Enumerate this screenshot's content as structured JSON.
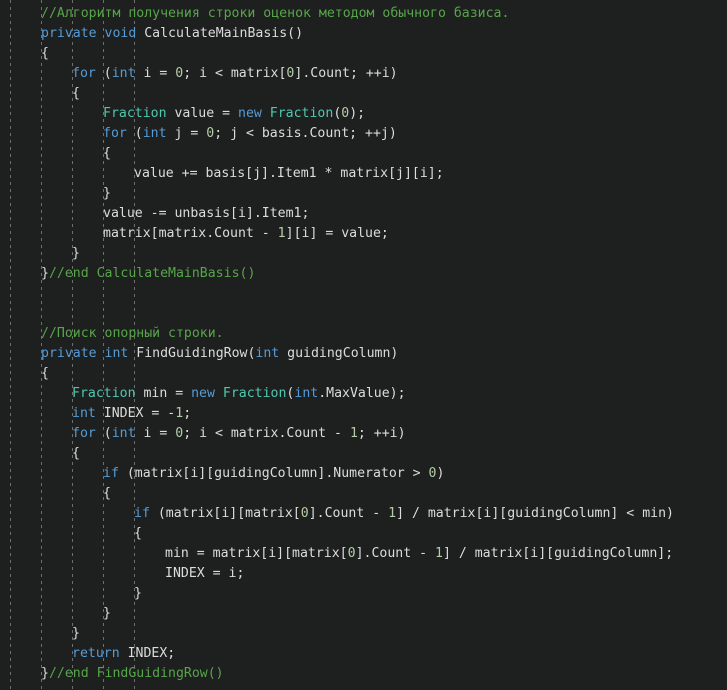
{
  "editor": {
    "name": "code-editor",
    "language": "C#",
    "background_color": "#1e1f1f",
    "indent_guide_color": "#6e6e6e",
    "colors": {
      "comment": "#57a64a",
      "keyword": "#569cd6",
      "type": "#4ec9b0",
      "plain": "#dcdcdc",
      "number": "#b5cea8"
    },
    "indent_guide_x": [
      10,
      41,
      72,
      103,
      134
    ],
    "line_height": 20,
    "char_width": 7.75
  },
  "lines": [
    {
      "n": 1,
      "indent": 4,
      "text": "//Алгоритм получения строки оценок методом обычного базиса.",
      "tokens": [
        {
          "t": "//Алгоритм получения строки оценок методом обычного базиса.",
          "c": "cmt"
        }
      ]
    },
    {
      "n": 2,
      "indent": 4,
      "text": "private void CalculateMainBasis()",
      "tokens": [
        {
          "t": "private",
          "c": "kw"
        },
        {
          "t": " ",
          "c": "pln"
        },
        {
          "t": "void",
          "c": "kw"
        },
        {
          "t": " CalculateMainBasis()",
          "c": "pln"
        }
      ]
    },
    {
      "n": 3,
      "indent": 4,
      "text": "{",
      "tokens": [
        {
          "t": "{",
          "c": "pun"
        }
      ]
    },
    {
      "n": 4,
      "indent": 8,
      "text": "for (int i = 0; i < matrix[0].Count; ++i)",
      "tokens": [
        {
          "t": "for",
          "c": "kw"
        },
        {
          "t": " (",
          "c": "pun"
        },
        {
          "t": "int",
          "c": "kw"
        },
        {
          "t": " i = ",
          "c": "pln"
        },
        {
          "t": "0",
          "c": "num"
        },
        {
          "t": "; i < matrix[",
          "c": "pln"
        },
        {
          "t": "0",
          "c": "num"
        },
        {
          "t": "].Count; ++i)",
          "c": "pln"
        }
      ]
    },
    {
      "n": 5,
      "indent": 8,
      "text": "{",
      "tokens": [
        {
          "t": "{",
          "c": "pun"
        }
      ]
    },
    {
      "n": 6,
      "indent": 12,
      "text": "Fraction value = new Fraction(0);",
      "tokens": [
        {
          "t": "Fraction",
          "c": "typ"
        },
        {
          "t": " value = ",
          "c": "pln"
        },
        {
          "t": "new",
          "c": "kw"
        },
        {
          "t": " ",
          "c": "pln"
        },
        {
          "t": "Fraction",
          "c": "typ"
        },
        {
          "t": "(",
          "c": "pun"
        },
        {
          "t": "0",
          "c": "num"
        },
        {
          "t": ");",
          "c": "pun"
        }
      ]
    },
    {
      "n": 7,
      "indent": 12,
      "text": "for (int j = 0; j < basis.Count; ++j)",
      "tokens": [
        {
          "t": "for",
          "c": "kw"
        },
        {
          "t": " (",
          "c": "pun"
        },
        {
          "t": "int",
          "c": "kw"
        },
        {
          "t": " j = ",
          "c": "pln"
        },
        {
          "t": "0",
          "c": "num"
        },
        {
          "t": "; j < basis.Count; ++j)",
          "c": "pln"
        }
      ]
    },
    {
      "n": 8,
      "indent": 12,
      "text": "{",
      "tokens": [
        {
          "t": "{",
          "c": "pun"
        }
      ]
    },
    {
      "n": 9,
      "indent": 16,
      "text": "value += basis[j].Item1 * matrix[j][i];",
      "tokens": [
        {
          "t": "value += basis[j].Item1 * matrix[j][i];",
          "c": "pln"
        }
      ]
    },
    {
      "n": 10,
      "indent": 12,
      "text": "}",
      "tokens": [
        {
          "t": "}",
          "c": "pun"
        }
      ]
    },
    {
      "n": 11,
      "indent": 12,
      "text": "value -= unbasis[i].Item1;",
      "tokens": [
        {
          "t": "value -= unbasis[i].Item1;",
          "c": "pln"
        }
      ]
    },
    {
      "n": 12,
      "indent": 12,
      "text": "matrix[matrix.Count - 1][i] = value;",
      "tokens": [
        {
          "t": "matrix[matrix.Count - ",
          "c": "pln"
        },
        {
          "t": "1",
          "c": "num"
        },
        {
          "t": "][i] = value;",
          "c": "pln"
        }
      ]
    },
    {
      "n": 13,
      "indent": 8,
      "text": "}",
      "tokens": [
        {
          "t": "}",
          "c": "pun"
        }
      ]
    },
    {
      "n": 14,
      "indent": 4,
      "text": "}//end CalculateMainBasis()",
      "tokens": [
        {
          "t": "}",
          "c": "pun"
        },
        {
          "t": "//end CalculateMainBasis()",
          "c": "cmt"
        }
      ]
    },
    {
      "n": 15,
      "indent": 0,
      "text": "",
      "tokens": []
    },
    {
      "n": 16,
      "indent": 0,
      "text": "",
      "tokens": []
    },
    {
      "n": 17,
      "indent": 4,
      "text": "//Поиск опорный строки.",
      "tokens": [
        {
          "t": "//Поиск опорный строки.",
          "c": "cmt"
        }
      ]
    },
    {
      "n": 18,
      "indent": 4,
      "text": "private int FindGuidingRow(int guidingColumn)",
      "tokens": [
        {
          "t": "private",
          "c": "kw"
        },
        {
          "t": " ",
          "c": "pln"
        },
        {
          "t": "int",
          "c": "kw"
        },
        {
          "t": " FindGuidingRow(",
          "c": "pln"
        },
        {
          "t": "int",
          "c": "kw"
        },
        {
          "t": " guidingColumn)",
          "c": "pln"
        }
      ]
    },
    {
      "n": 19,
      "indent": 4,
      "text": "{",
      "tokens": [
        {
          "t": "{",
          "c": "pun"
        }
      ]
    },
    {
      "n": 20,
      "indent": 8,
      "text": "Fraction min = new Fraction(int.MaxValue);",
      "tokens": [
        {
          "t": "Fraction",
          "c": "typ"
        },
        {
          "t": " min = ",
          "c": "pln"
        },
        {
          "t": "new",
          "c": "kw"
        },
        {
          "t": " ",
          "c": "pln"
        },
        {
          "t": "Fraction",
          "c": "typ"
        },
        {
          "t": "(",
          "c": "pun"
        },
        {
          "t": "int",
          "c": "kw"
        },
        {
          "t": ".MaxValue);",
          "c": "pln"
        }
      ]
    },
    {
      "n": 21,
      "indent": 8,
      "text": "int INDEX = -1;",
      "tokens": [
        {
          "t": "int",
          "c": "kw"
        },
        {
          "t": " INDEX = -",
          "c": "pln"
        },
        {
          "t": "1",
          "c": "num"
        },
        {
          "t": ";",
          "c": "pun"
        }
      ]
    },
    {
      "n": 22,
      "indent": 8,
      "text": "for (int i = 0; i < matrix.Count - 1; ++i)",
      "tokens": [
        {
          "t": "for",
          "c": "kw"
        },
        {
          "t": " (",
          "c": "pun"
        },
        {
          "t": "int",
          "c": "kw"
        },
        {
          "t": " i = ",
          "c": "pln"
        },
        {
          "t": "0",
          "c": "num"
        },
        {
          "t": "; i < matrix.Count - ",
          "c": "pln"
        },
        {
          "t": "1",
          "c": "num"
        },
        {
          "t": "; ++i)",
          "c": "pln"
        }
      ]
    },
    {
      "n": 23,
      "indent": 8,
      "text": "{",
      "tokens": [
        {
          "t": "{",
          "c": "pun"
        }
      ]
    },
    {
      "n": 24,
      "indent": 12,
      "text": "if (matrix[i][guidingColumn].Numerator > 0)",
      "tokens": [
        {
          "t": "if",
          "c": "kw"
        },
        {
          "t": " (matrix[i][guidingColumn].Numerator > ",
          "c": "pln"
        },
        {
          "t": "0",
          "c": "num"
        },
        {
          "t": ")",
          "c": "pun"
        }
      ]
    },
    {
      "n": 25,
      "indent": 12,
      "text": "{",
      "tokens": [
        {
          "t": "{",
          "c": "pun"
        }
      ]
    },
    {
      "n": 26,
      "indent": 16,
      "text": "if (matrix[i][matrix[0].Count - 1] / matrix[i][guidingColumn] < min)",
      "tokens": [
        {
          "t": "if",
          "c": "kw"
        },
        {
          "t": " (matrix[i][matrix[",
          "c": "pln"
        },
        {
          "t": "0",
          "c": "num"
        },
        {
          "t": "].Count - ",
          "c": "pln"
        },
        {
          "t": "1",
          "c": "num"
        },
        {
          "t": "] / matrix[i][guidingColumn] < min)",
          "c": "pln"
        }
      ]
    },
    {
      "n": 27,
      "indent": 16,
      "text": "{",
      "tokens": [
        {
          "t": "{",
          "c": "pun"
        }
      ]
    },
    {
      "n": 28,
      "indent": 20,
      "text": "min = matrix[i][matrix[0].Count - 1] / matrix[i][guidingColumn];",
      "tokens": [
        {
          "t": "min = matrix[i][matrix[",
          "c": "pln"
        },
        {
          "t": "0",
          "c": "num"
        },
        {
          "t": "].Count - ",
          "c": "pln"
        },
        {
          "t": "1",
          "c": "num"
        },
        {
          "t": "] / matrix[i][guidingColumn];",
          "c": "pln"
        }
      ]
    },
    {
      "n": 29,
      "indent": 20,
      "text": "INDEX = i;",
      "tokens": [
        {
          "t": "INDEX = i;",
          "c": "pln"
        }
      ]
    },
    {
      "n": 30,
      "indent": 16,
      "text": "}",
      "tokens": [
        {
          "t": "}",
          "c": "pun"
        }
      ]
    },
    {
      "n": 31,
      "indent": 12,
      "text": "}",
      "tokens": [
        {
          "t": "}",
          "c": "pun"
        }
      ]
    },
    {
      "n": 32,
      "indent": 8,
      "text": "}",
      "tokens": [
        {
          "t": "}",
          "c": "pun"
        }
      ]
    },
    {
      "n": 33,
      "indent": 8,
      "text": "return INDEX;",
      "tokens": [
        {
          "t": "return",
          "c": "kw"
        },
        {
          "t": " INDEX;",
          "c": "pln"
        }
      ]
    },
    {
      "n": 34,
      "indent": 4,
      "text": "}//end FindGuidingRow()",
      "tokens": [
        {
          "t": "}",
          "c": "pun"
        },
        {
          "t": "//end FindGuidingRow()",
          "c": "cmt"
        }
      ]
    }
  ]
}
